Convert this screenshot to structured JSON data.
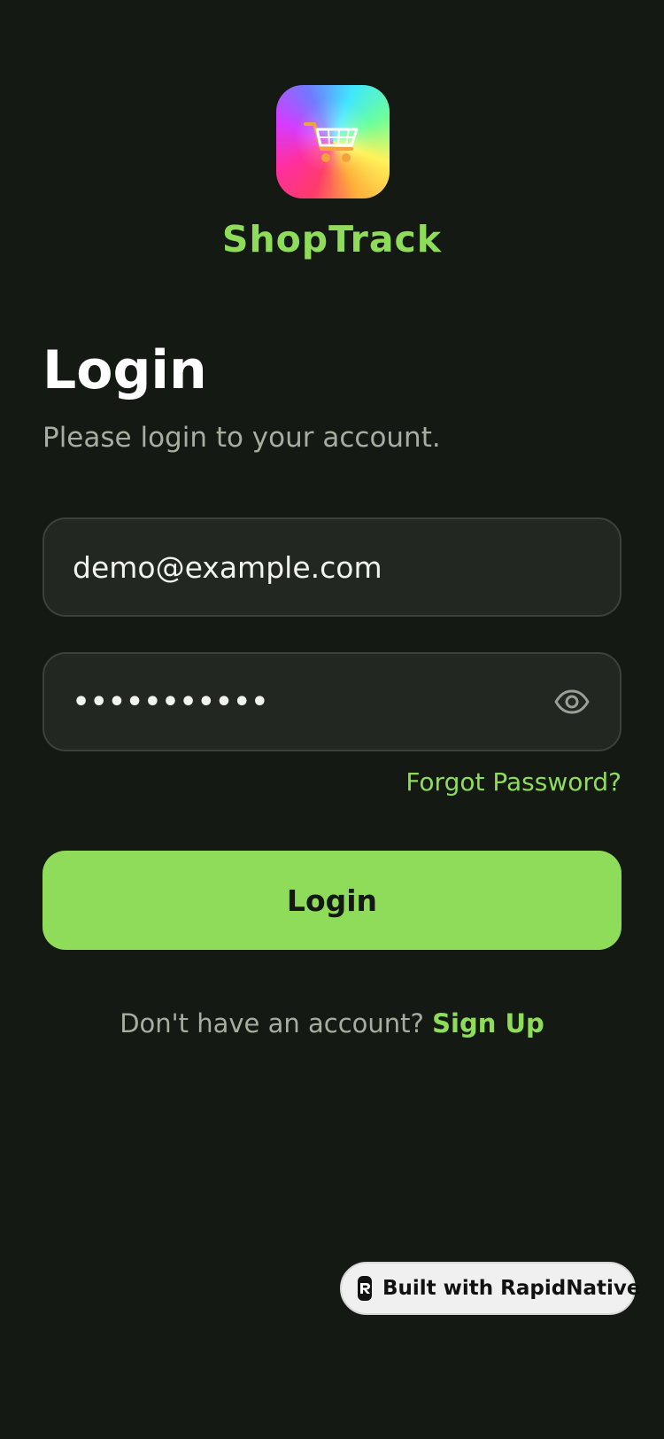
{
  "app": {
    "name": "ShopTrack",
    "icon": "shopping-cart-icon",
    "colors": {
      "accent": "#8fdc5a",
      "background": "#151914",
      "input_bg": "#232722"
    }
  },
  "header": {
    "title": "Login",
    "subtitle": "Please login to your account."
  },
  "form": {
    "email_value": "demo@example.com",
    "password_masked": "•••••••••••",
    "forgot_label": "Forgot Password?",
    "login_label": "Login",
    "eye_icon": "eye-icon"
  },
  "footer": {
    "prompt": "Don't have an account? ",
    "signup_label": "Sign Up"
  },
  "badge": {
    "label": "Built with RapidNative",
    "icon": "rapidnative-logo-icon"
  }
}
